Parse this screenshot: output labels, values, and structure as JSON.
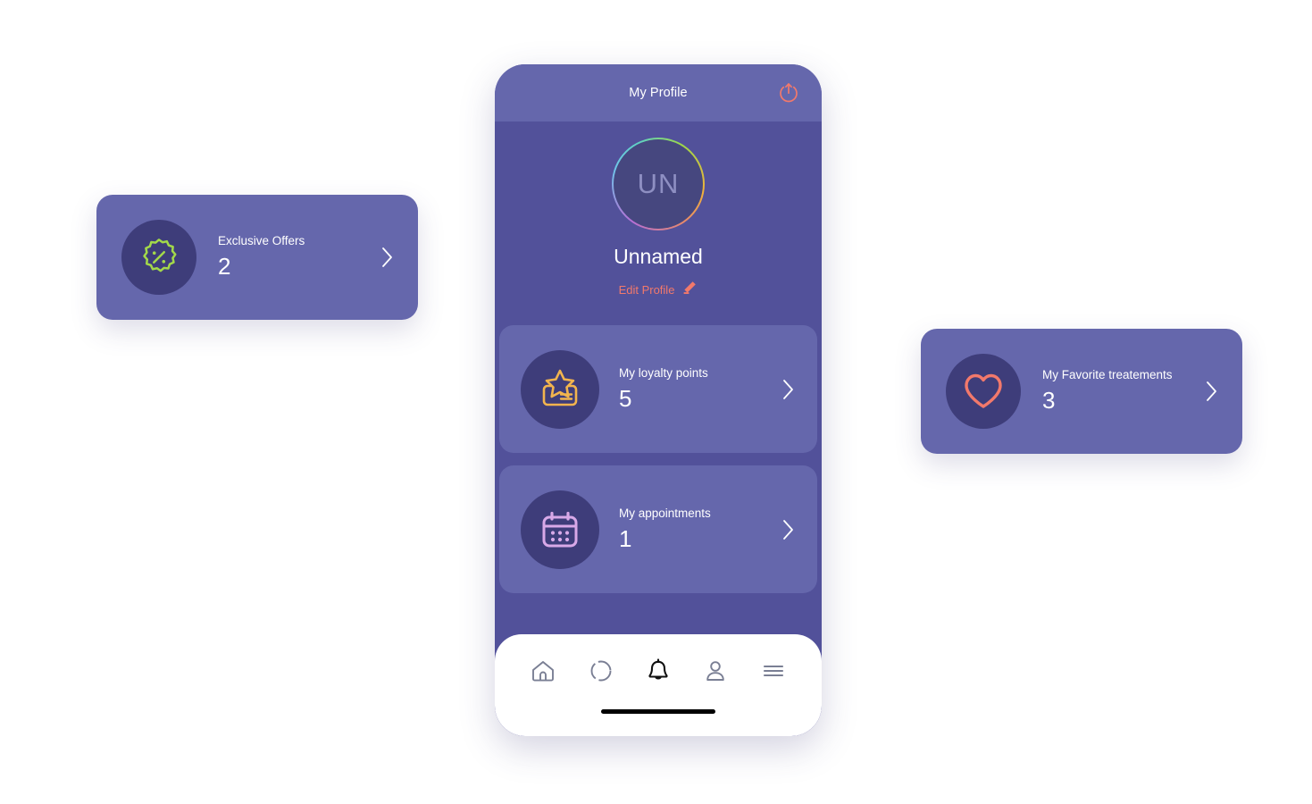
{
  "phone": {
    "header": {
      "title": "My Profile",
      "logout_icon": "power-logout-icon"
    },
    "profile": {
      "avatar_initials": "UN",
      "name": "Unnamed",
      "edit_label": "Edit Profile",
      "edit_icon": "pencil-icon",
      "avatar_ring_colors": [
        "#b56fd6",
        "#6fc5e8",
        "#5fd1c3",
        "#9bd84a",
        "#f0b13c",
        "#e88a6a"
      ]
    },
    "cards": [
      {
        "id": "loyalty-points",
        "label": "My loyalty points",
        "value": "5",
        "icon": "star-card-icon",
        "icon_color": "#f2b44e"
      },
      {
        "id": "appointments",
        "label": "My appointments",
        "value": "1",
        "icon": "calendar-icon",
        "icon_color": "#d8a9e8"
      }
    ],
    "bottom_nav": [
      {
        "id": "home",
        "icon": "home-icon",
        "active": false
      },
      {
        "id": "discover",
        "icon": "dashed-circle-icon",
        "active": false
      },
      {
        "id": "notifications",
        "icon": "bell-icon",
        "active": true
      },
      {
        "id": "account",
        "icon": "person-icon",
        "active": false
      },
      {
        "id": "menu",
        "icon": "hamburger-menu-icon",
        "active": false
      }
    ]
  },
  "floating_cards": [
    {
      "id": "exclusive-offers",
      "label": "Exclusive Offers",
      "value": "2",
      "icon": "discount-badge-icon",
      "icon_color": "#a3d94a"
    },
    {
      "id": "favorite-treatments",
      "label": "My Favorite treatements",
      "value": "3",
      "icon": "heart-icon",
      "icon_color": "#f2796b"
    }
  ],
  "theme": {
    "page_background": "#ffffff",
    "phone_background": "#52519a",
    "card_background": "#6567ac",
    "icon_circle_background": "#3e3d7a",
    "accent_coral": "#f2796b",
    "text_primary": "#ffffff",
    "nav_inactive": "#7a7f94",
    "nav_active": "#111111"
  }
}
